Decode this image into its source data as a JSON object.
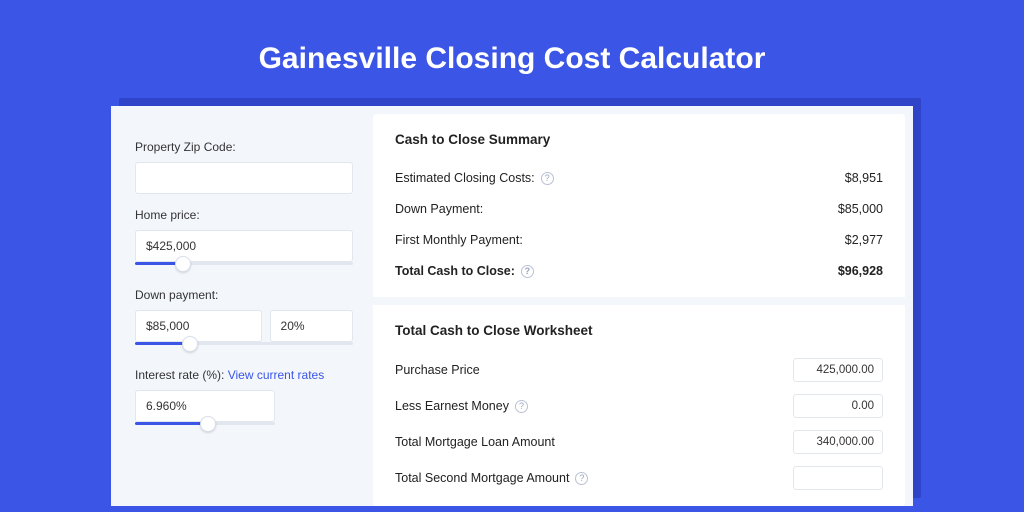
{
  "title": "Gainesville Closing Cost Calculator",
  "sidebar": {
    "zip": {
      "label": "Property Zip Code:",
      "value": ""
    },
    "price": {
      "label": "Home price:",
      "value": "$425,000",
      "slider_pct": 22
    },
    "down": {
      "label": "Down payment:",
      "value": "$85,000",
      "pct": "20%",
      "slider_pct": 25
    },
    "rate": {
      "label": "Interest rate (%):",
      "link": "View current rates",
      "value": "6.960%",
      "slider_pct": 52
    }
  },
  "summary": {
    "heading": "Cash to Close Summary",
    "rows": [
      {
        "label": "Estimated Closing Costs:",
        "help": true,
        "value": "$8,951"
      },
      {
        "label": "Down Payment:",
        "help": false,
        "value": "$85,000"
      },
      {
        "label": "First Monthly Payment:",
        "help": false,
        "value": "$2,977"
      }
    ],
    "total": {
      "label": "Total Cash to Close:",
      "help": true,
      "value": "$96,928"
    }
  },
  "worksheet": {
    "heading": "Total Cash to Close Worksheet",
    "rows": [
      {
        "label": "Purchase Price",
        "help": false,
        "value": "425,000.00"
      },
      {
        "label": "Less Earnest Money",
        "help": true,
        "value": "0.00"
      },
      {
        "label": "Total Mortgage Loan Amount",
        "help": false,
        "value": "340,000.00"
      },
      {
        "label": "Total Second Mortgage Amount",
        "help": true,
        "value": ""
      }
    ]
  }
}
